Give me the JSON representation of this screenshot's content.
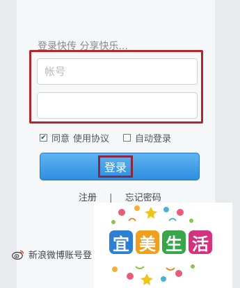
{
  "login": {
    "slogan": "登录快传 分享快乐...",
    "account_placeholder": "帐号",
    "password_value": "",
    "agree_label": "同意",
    "agreement_link": "使用协议",
    "auto_login_label": "自动登录",
    "agree_checked": true,
    "auto_login_checked": false,
    "submit_label": "登录",
    "register_link": "注册",
    "separator": "|",
    "forgot_link": "忘记密码",
    "weibo_text": "新浪微博账号登"
  },
  "watermark": {
    "characters": [
      "宜",
      "美",
      "生",
      "活"
    ],
    "char_colors": [
      "#2d7fd3",
      "#f0a01c",
      "#3aa64c",
      "#d4327e"
    ]
  },
  "colors": {
    "highlight_frame": "#b3262a",
    "button_gradient_top": "#5fb3f1",
    "button_gradient_bottom": "#2f8ee0",
    "label_frame": "#8c2740"
  }
}
